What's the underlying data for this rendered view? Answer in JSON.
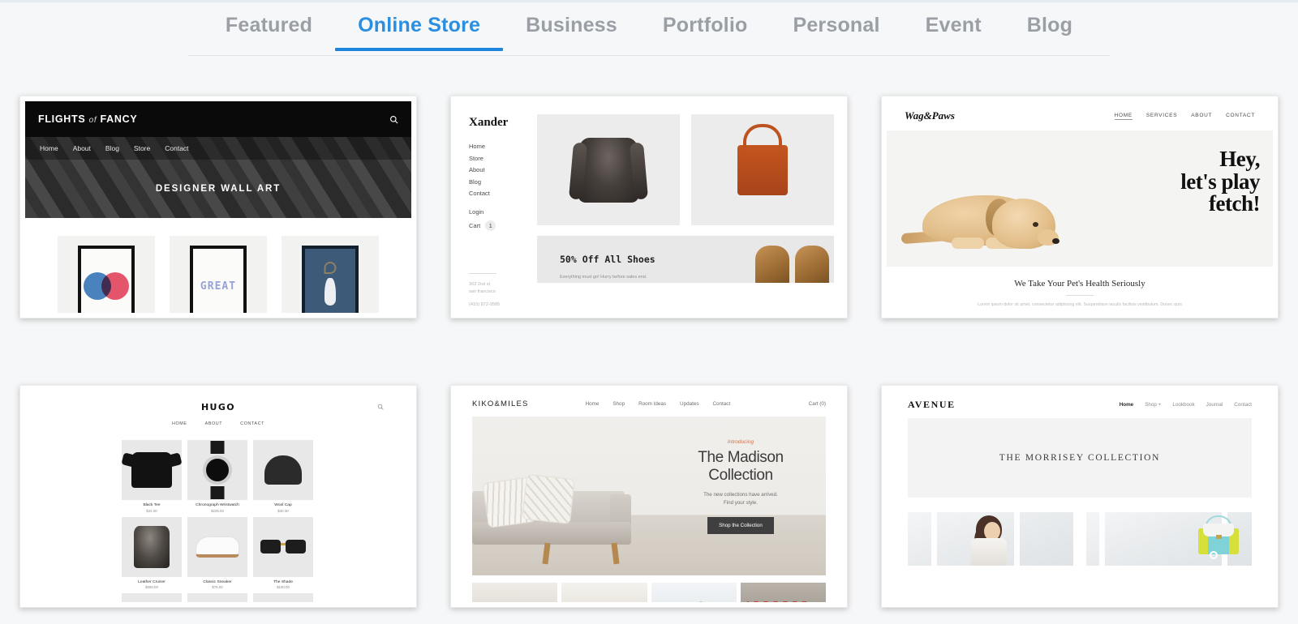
{
  "tabs": [
    {
      "label": "Featured",
      "active": false
    },
    {
      "label": "Online Store",
      "active": true
    },
    {
      "label": "Business",
      "active": false
    },
    {
      "label": "Portfolio",
      "active": false
    },
    {
      "label": "Personal",
      "active": false
    },
    {
      "label": "Event",
      "active": false
    },
    {
      "label": "Blog",
      "active": false
    }
  ],
  "colors": {
    "accent": "#1d85dd",
    "active_tab_text": "#2a8fe0",
    "inactive_tab_text": "#9a9fa6",
    "page_background": "#f6f7f8",
    "card_background": "#ffffff"
  },
  "templates": {
    "flights_of_fancy": {
      "logo_main": "FLIGHTS",
      "logo_mid": "of",
      "logo_end": "FANCY",
      "nav": [
        "Home",
        "About",
        "Blog",
        "Store",
        "Contact"
      ],
      "hero_title": "DESIGNER WALL ART",
      "art_great": "GREAT",
      "search_icon": "search-icon"
    },
    "xander": {
      "logo": "Xander",
      "nav": [
        "Home",
        "Store",
        "About",
        "Blog",
        "Contact"
      ],
      "account": [
        "Login",
        "Cart"
      ],
      "cart_count": "1",
      "address_line1": "303 2nd st",
      "address_line2": "san francisco",
      "phone": "(415) 872-9585",
      "promo_title": "50% Off All Shoes",
      "promo_sub": "Everything must go! Hurry before sales end."
    },
    "wag_and_paws": {
      "logo": "Wag&Paws",
      "nav": [
        "HOME",
        "SERVICES",
        "ABOUT",
        "CONTACT"
      ],
      "hero_line1": "Hey,",
      "hero_line2": "let's play",
      "hero_line3": "fetch!",
      "section_title": "We Take Your Pet's Health Seriously",
      "body_text": "Lorem ipsum dolor sit amet, consectetur adipiscing elit. Suspendisse iaculis facilisis vestibulum. Donec quis"
    },
    "hugo": {
      "logo": "HUGO",
      "nav": [
        "HOME",
        "ABOUT",
        "CONTACT"
      ],
      "search_icon": "search-icon",
      "products": [
        {
          "name": "Black Tee",
          "price": "$24.00"
        },
        {
          "name": "Chronograph Wristwatch",
          "price": "$225.00"
        },
        {
          "name": "Wool Cap",
          "price": "$30.00"
        },
        {
          "name": "Leather Cruiser",
          "price": "$350.00"
        },
        {
          "name": "Classic Sneaker",
          "price": "$75.00"
        },
        {
          "name": "The Shade",
          "price": "$150.00"
        }
      ]
    },
    "kiko_and_miles": {
      "logo": "KIKO&MILES",
      "nav": [
        "Home",
        "Shop",
        "Room Ideas",
        "Updates",
        "Contact"
      ],
      "cart": "Cart (0)",
      "intro": "Introducing",
      "heading_line1": "The Madison",
      "heading_line2": "Collection",
      "subtext_line1": "The new collections have arrived.",
      "subtext_line2": "Find your style.",
      "cta": "Shop the Collection",
      "intro_color": "#d2714a"
    },
    "avenue": {
      "logo": "AVENUE",
      "nav": [
        "Home",
        "Shop +",
        "Lookbook",
        "Journal",
        "Contact"
      ],
      "banner_title": "THE MORRISEY COLLECTION"
    }
  }
}
